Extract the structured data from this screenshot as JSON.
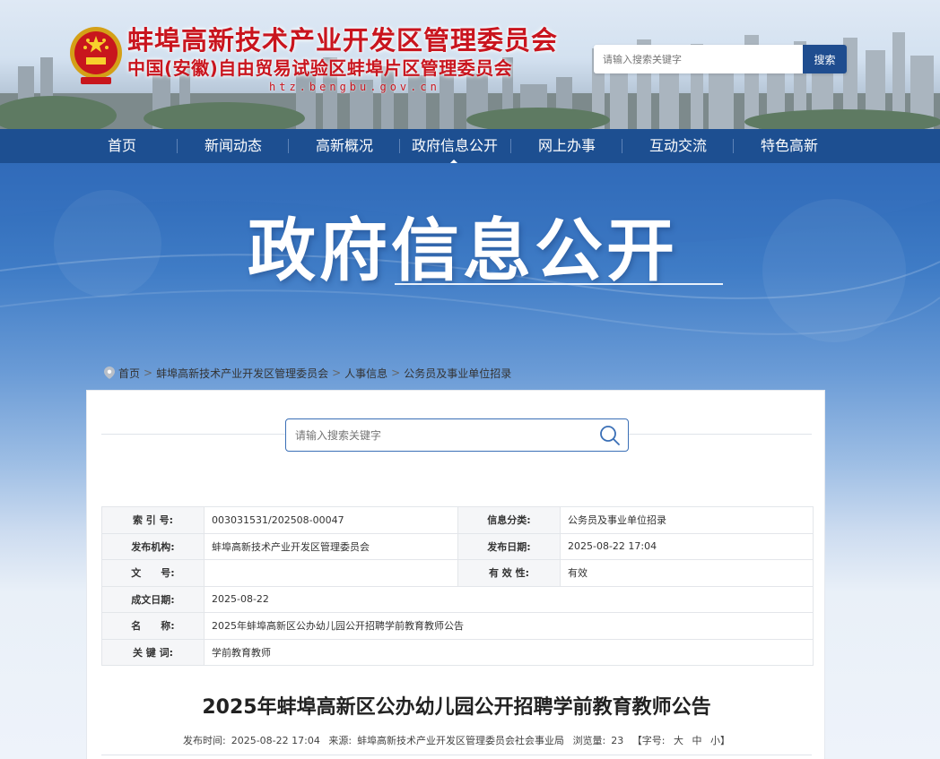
{
  "header": {
    "title": "蚌埠高新技术产业开发区管理委员会",
    "subtitle": "中国(安徽)自由贸易试验区蚌埠片区管理委员会",
    "domain": "htz.bengbu.gov.cn",
    "search_placeholder": "请输入搜索关键字",
    "search_button": "搜索"
  },
  "nav": {
    "items": [
      "首页",
      "新闻动态",
      "高新概况",
      "政府信息公开",
      "网上办事",
      "互动交流",
      "特色高新"
    ],
    "active": "政府信息公开"
  },
  "banner": {
    "title": "政府信息公开"
  },
  "breadcrumb": [
    "首页",
    "蚌埠高新技术产业开发区管理委员会",
    "人事信息",
    "公务员及事业单位招录"
  ],
  "panel_search": {
    "placeholder": "请输入搜索关键字"
  },
  "info": {
    "index_label": "索 引 号:",
    "index_value": "003031531/202508-00047",
    "category_label": "信息分类:",
    "category_value": "公务员及事业单位招录",
    "publisher_label": "发布机构:",
    "publisher_value": "蚌埠高新技术产业开发区管理委员会",
    "pubdate_label": "发布日期:",
    "pubdate_value": "2025-08-22 17:04",
    "docno_label": "文　　号:",
    "docno_value": "",
    "valid_label": "有 效 性:",
    "valid_value": "有效",
    "created_label": "成文日期:",
    "created_value": "2025-08-22",
    "name_label": "名　　称:",
    "name_value": "2025年蚌埠高新区公办幼儿园公开招聘学前教育教师公告",
    "keywords_label": "关 键 词:",
    "keywords_value": "学前教育教师"
  },
  "article": {
    "title": "2025年蚌埠高新区公办幼儿园公开招聘学前教育教师公告",
    "time_label": "发布时间:",
    "time_value": "2025-08-22 17:04",
    "source_label": "来源:",
    "source_value": "蚌埠高新技术产业开发区管理委员会社会事业局",
    "views_label": "浏览量:",
    "views_value": "23",
    "font_label": "【字号:",
    "font_large": "大",
    "font_medium": "中",
    "font_small": "小】"
  },
  "colors": {
    "brand_red": "#c9151e",
    "nav_blue": "#1d4f91",
    "accent_blue": "#3a6fb6"
  }
}
